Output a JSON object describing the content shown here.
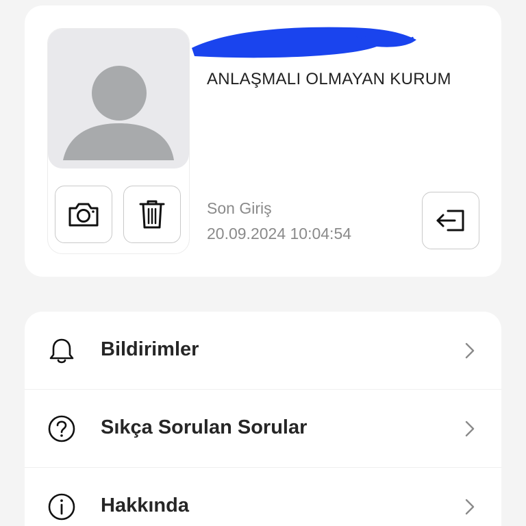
{
  "profile": {
    "organization": "ANLAŞMALI OLMAYAN KURUM",
    "last_login_label": "Son Giriş",
    "last_login_value": "20.09.2024 10:04:54",
    "redaction_color": "#1a44ee"
  },
  "icons": {
    "avatar": "avatar-placeholder-icon",
    "camera": "camera-icon",
    "trash": "trash-icon",
    "logout": "logout-icon",
    "bell": "bell-icon",
    "question": "question-circle-icon",
    "info": "info-circle-icon",
    "chevron": "chevron-right-icon"
  },
  "menu": {
    "items": [
      {
        "label": "Bildirimler",
        "icon": "bell-icon"
      },
      {
        "label": "Sıkça Sorulan Sorular",
        "icon": "question-circle-icon"
      },
      {
        "label": "Hakkında",
        "icon": "info-circle-icon"
      }
    ]
  }
}
